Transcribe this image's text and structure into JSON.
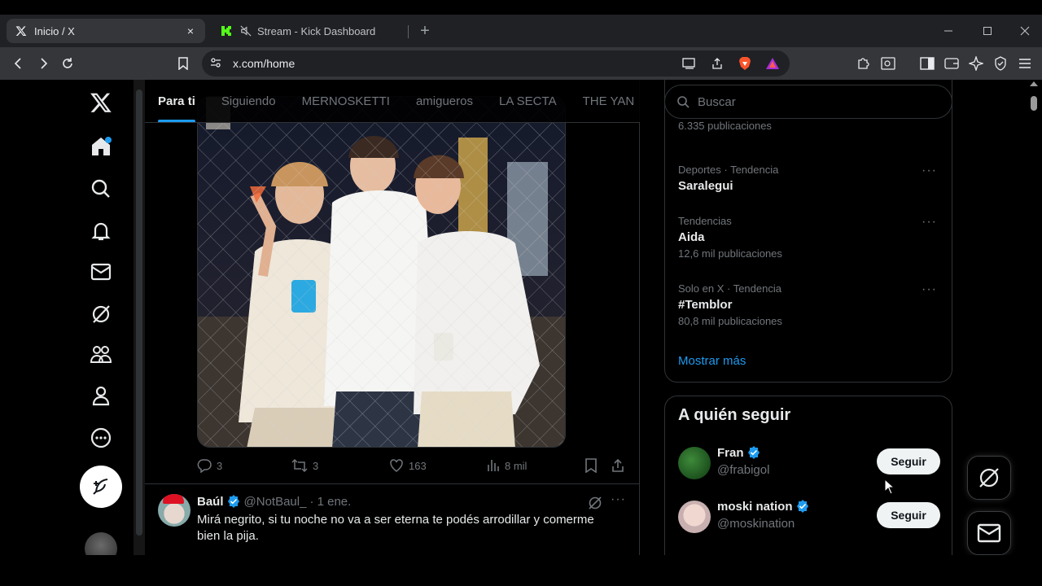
{
  "browser": {
    "tabs": [
      {
        "title": "Inicio / X",
        "favicon": "x-logo-icon",
        "close": "×"
      },
      {
        "title": "Stream - Kick Dashboard",
        "favicon": "kick-logo-icon",
        "muted": true
      }
    ],
    "new_tab": "+",
    "url": "x.com/home"
  },
  "feed": {
    "tabs": [
      {
        "label": "Para ti",
        "active": true
      },
      {
        "label": "Siguiendo"
      },
      {
        "label": "MERNOSKETTI"
      },
      {
        "label": "amigueros"
      },
      {
        "label": "LA SECTA"
      },
      {
        "label": "THE YAN"
      }
    ],
    "post1": {
      "replies": "3",
      "reposts": "3",
      "likes": "163",
      "views": "8 mil"
    },
    "post2": {
      "name": "Baúl",
      "handle": "@NotBaul_",
      "time": "· 1 ene.",
      "text": "Mirá negrito, si tu noche no va a ser eterna te podés arrodillar y comerme bien la pija."
    }
  },
  "sidebar": {
    "search_placeholder": "Buscar",
    "trends": [
      {
        "meta": "",
        "name": "",
        "count": "6.335 publicaciones"
      },
      {
        "meta": "Deportes · Tendencia",
        "name": "Saralegui",
        "count": ""
      },
      {
        "meta": "Tendencias",
        "name": "Aida",
        "count": "12,6 mil publicaciones"
      },
      {
        "meta": "Solo en X · Tendencia",
        "name": "#Temblor",
        "count": "80,8 mil publicaciones"
      }
    ],
    "show_more": "Mostrar más",
    "who_to_follow": {
      "title": "A quién seguir",
      "accounts": [
        {
          "name": "Fran",
          "handle": "@frabigol",
          "button": "Seguir"
        },
        {
          "name": "moski nation",
          "handle": "@moskination",
          "button": "Seguir"
        }
      ]
    }
  },
  "colors": {
    "accent": "#1d9bf0",
    "background": "#000000",
    "text": "#e7e9ea",
    "muted": "#71767b"
  }
}
